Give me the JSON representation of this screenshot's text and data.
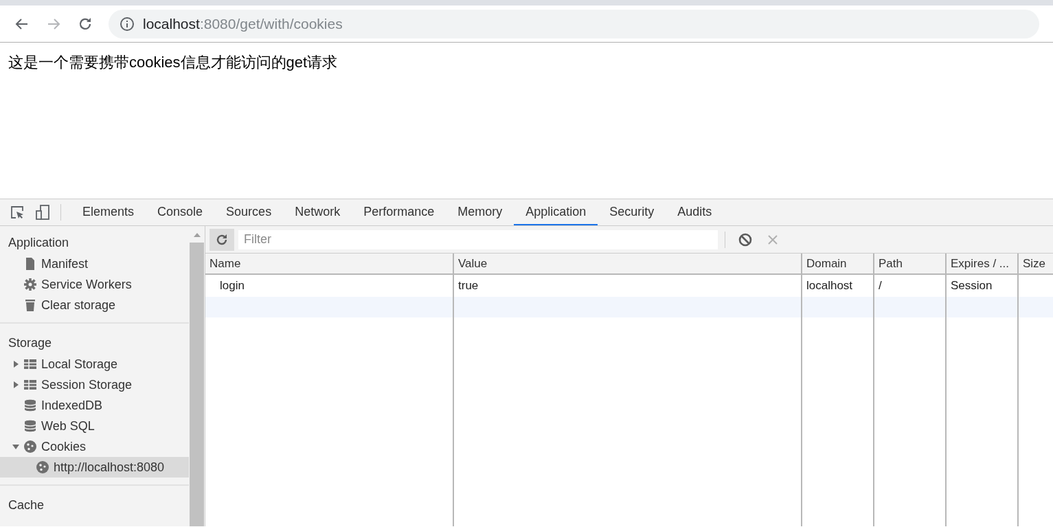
{
  "browser": {
    "address_host": "localhost",
    "address_path": ":8080/get/with/cookies"
  },
  "page": {
    "text": "这是一个需要携带cookies信息才能访问的get请求"
  },
  "devtools": {
    "tabs": [
      {
        "label": "Elements",
        "selected": false
      },
      {
        "label": "Console",
        "selected": false
      },
      {
        "label": "Sources",
        "selected": false
      },
      {
        "label": "Network",
        "selected": false
      },
      {
        "label": "Performance",
        "selected": false
      },
      {
        "label": "Memory",
        "selected": false
      },
      {
        "label": "Application",
        "selected": true
      },
      {
        "label": "Security",
        "selected": false
      },
      {
        "label": "Audits",
        "selected": false
      }
    ],
    "sidebar": {
      "sections": [
        {
          "title": "Application",
          "items": [
            {
              "label": "Manifest",
              "kind": "file",
              "selected": false
            },
            {
              "label": "Service Workers",
              "kind": "gear",
              "selected": false
            },
            {
              "label": "Clear storage",
              "kind": "trash",
              "selected": false
            }
          ]
        },
        {
          "title": "Storage",
          "items": [
            {
              "label": "Local Storage",
              "kind": "grid",
              "expanded": false,
              "selected": false
            },
            {
              "label": "Session Storage",
              "kind": "grid",
              "expanded": false,
              "selected": false
            },
            {
              "label": "IndexedDB",
              "kind": "db",
              "selected": false
            },
            {
              "label": "Web SQL",
              "kind": "db",
              "selected": false
            },
            {
              "label": "Cookies",
              "kind": "cookie",
              "expanded": true,
              "selected": false,
              "children": [
                {
                  "label": "http://localhost:8080",
                  "kind": "cookie",
                  "selected": true
                }
              ]
            }
          ]
        },
        {
          "title": "Cache"
        }
      ]
    },
    "filter": {
      "placeholder": "Filter"
    },
    "table": {
      "columns": [
        "Name",
        "Value",
        "Domain",
        "Path",
        "Expires / ...",
        "Size"
      ],
      "rows": [
        {
          "cells": [
            "login",
            "true",
            "localhost",
            "/",
            "Session",
            ""
          ],
          "selected": false
        }
      ]
    }
  }
}
